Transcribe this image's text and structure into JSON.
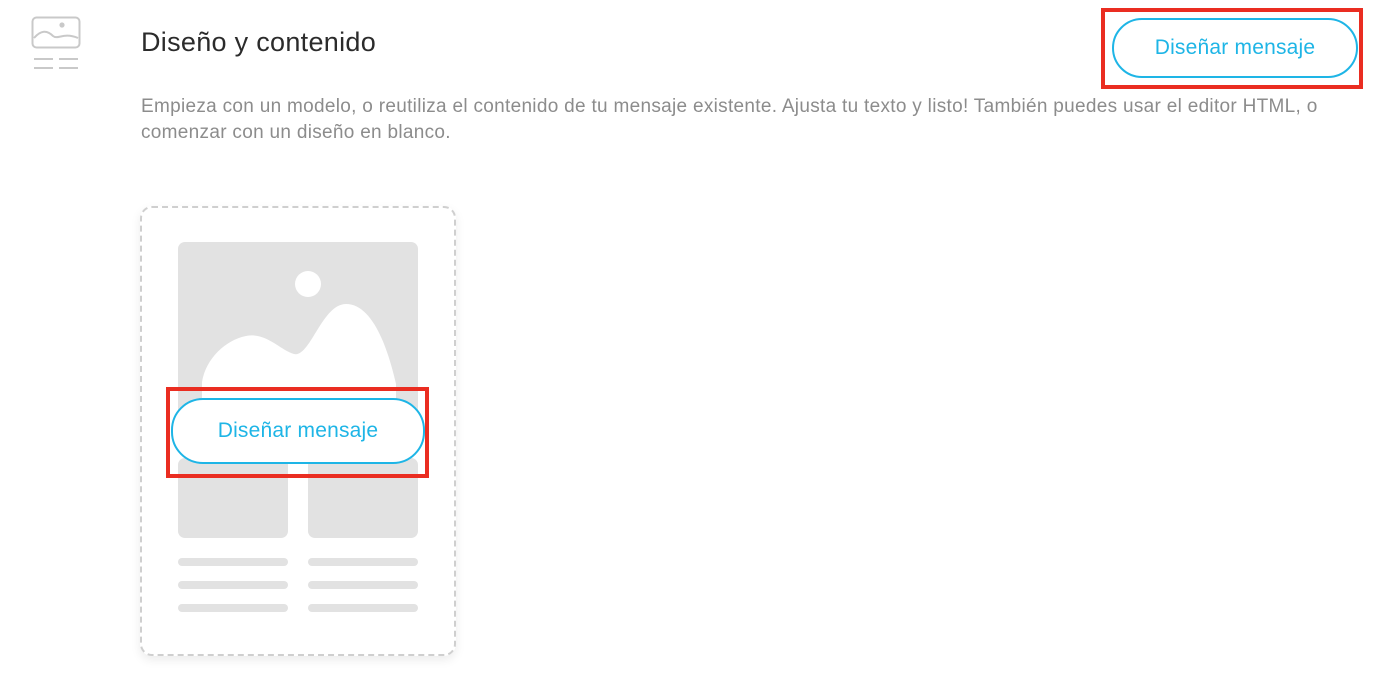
{
  "section": {
    "icon": "layout-template-icon",
    "title": "Diseño y contenido",
    "description": "Empieza con un modelo, o reutiliza el contenido de tu mensaje existente. Ajusta tu texto y listo! También puedes usar el editor HTML, o comenzar con un diseño en blanco."
  },
  "actions": {
    "design_button_label": "Diseñar mensaje"
  },
  "template_card": {
    "image_icon": "image-placeholder-icon",
    "button_label": "Diseñar mensaje"
  },
  "colors": {
    "accent": "#1eb5e6",
    "highlight": "#ea2d21",
    "placeholder": "#e2e2e2",
    "title": "#2b2b2b",
    "muted_text": "#8c8c8c"
  }
}
